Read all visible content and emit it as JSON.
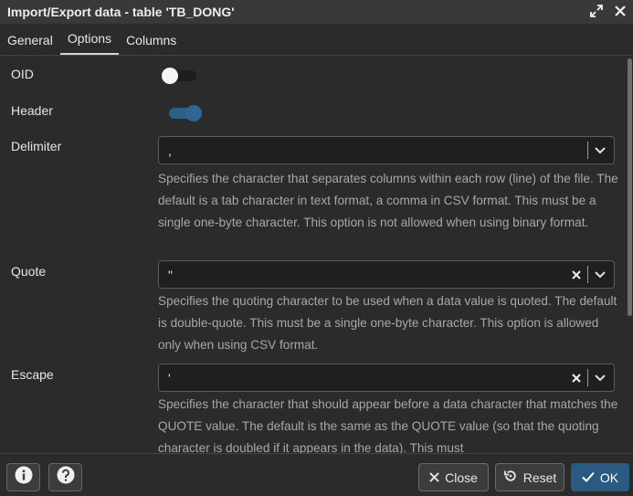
{
  "window": {
    "title": "Import/Export data - table 'TB_DONG'",
    "icons": [
      "expand-icon",
      "close-icon"
    ]
  },
  "tabs": [
    {
      "label": "General",
      "active": false
    },
    {
      "label": "Options",
      "active": true
    },
    {
      "label": "Columns",
      "active": false
    }
  ],
  "form": {
    "oid": {
      "label": "OID",
      "value": false
    },
    "header": {
      "label": "Header",
      "value": true
    },
    "delimiter": {
      "label": "Delimiter",
      "value": ",",
      "help": "Specifies the character that separates columns within each row (line) of the file. The default is a tab character in text format, a comma in CSV format. This must be a single one-byte character. This option is not allowed when using binary format."
    },
    "quote": {
      "label": "Quote",
      "value": "\"",
      "help": "Specifies the quoting character to be used when a data value is quoted. The default is double-quote. This must be a single one-byte character. This option is allowed only when using CSV format."
    },
    "escape": {
      "label": "Escape",
      "value": "'",
      "help": "Specifies the character that should appear before a data character that matches the QUOTE value. The default is the same as the QUOTE value (so that the quoting character is doubled if it appears in the data). This must"
    }
  },
  "footer": {
    "info_icon": "info-icon",
    "help_icon": "help-icon",
    "close_label": "Close",
    "reset_label": "Reset",
    "ok_label": "OK"
  },
  "colors": {
    "background": "#2b2b2b",
    "primary": "#2a5a82",
    "toggle_on": "#326690"
  }
}
